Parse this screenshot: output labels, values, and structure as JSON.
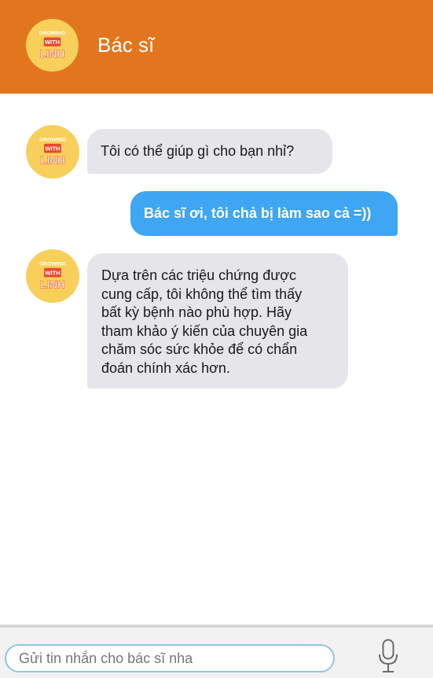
{
  "header": {
    "title": "Bác sĩ",
    "avatar_logo": [
      "GROWING",
      "WITH",
      "LINH"
    ]
  },
  "messages": [
    {
      "sender": "bot",
      "text": "Tôi có thể giúp gì cho bạn nhỉ?"
    },
    {
      "sender": "user",
      "text": "Bác sĩ ơi, tôi chả bị làm sao cả =))"
    },
    {
      "sender": "bot",
      "lines": [
        "Dựa trên các triệu chứng được",
        "cung cấp, tôi không thể tìm thấy",
        "bất kỳ bệnh nào phù hợp. Hãy",
        "tham khảo ý kiến của chuyên gia",
        "chăm sóc sức khỏe để có chẩn",
        "đoán chính xác hơn."
      ]
    }
  ],
  "composer": {
    "placeholder": "Gửi tin nhắn cho bác sĩ nha"
  },
  "colors": {
    "header": "#e2761f",
    "avatar": "#f7cf5a",
    "bot_bubble": "#e5e5ea",
    "user_bubble": "#3ea6f2",
    "logo_badge": "#e8482d"
  },
  "icons": {
    "composer_action": "microphone-icon"
  }
}
